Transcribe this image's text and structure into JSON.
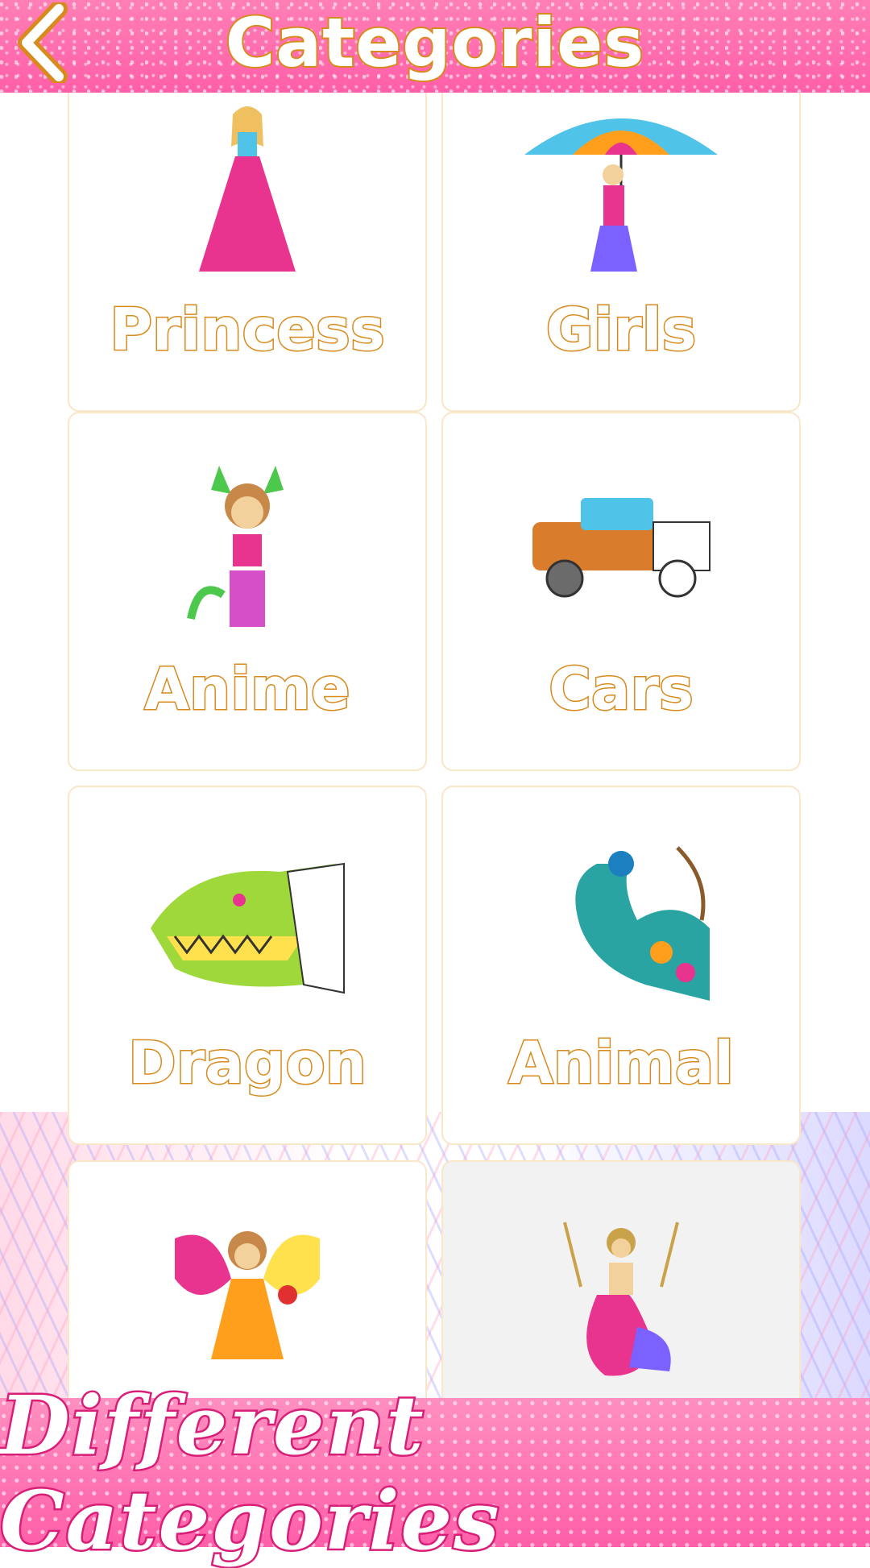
{
  "header": {
    "title": "Categories",
    "back_icon": "chevron-left-icon"
  },
  "categories": [
    {
      "label": "Princess",
      "art_icon": "princess-illustration"
    },
    {
      "label": "Girls",
      "art_icon": "girl-with-umbrella-illustration"
    },
    {
      "label": "Anime",
      "art_icon": "anime-catgirl-illustration"
    },
    {
      "label": "Cars",
      "art_icon": "truck-illustration"
    },
    {
      "label": "Dragon",
      "art_icon": "dragon-head-illustration"
    },
    {
      "label": "Animal",
      "art_icon": "peacock-illustration"
    },
    {
      "label": "",
      "art_icon": "fairy-illustration"
    },
    {
      "label": "",
      "art_icon": "mermaid-illustration"
    }
  ],
  "banner": {
    "text": "Different Categories"
  },
  "colors": {
    "pink": "#ff5fa8",
    "orange_outline": "#d88a1c",
    "card_border": "#f8e7c8"
  }
}
